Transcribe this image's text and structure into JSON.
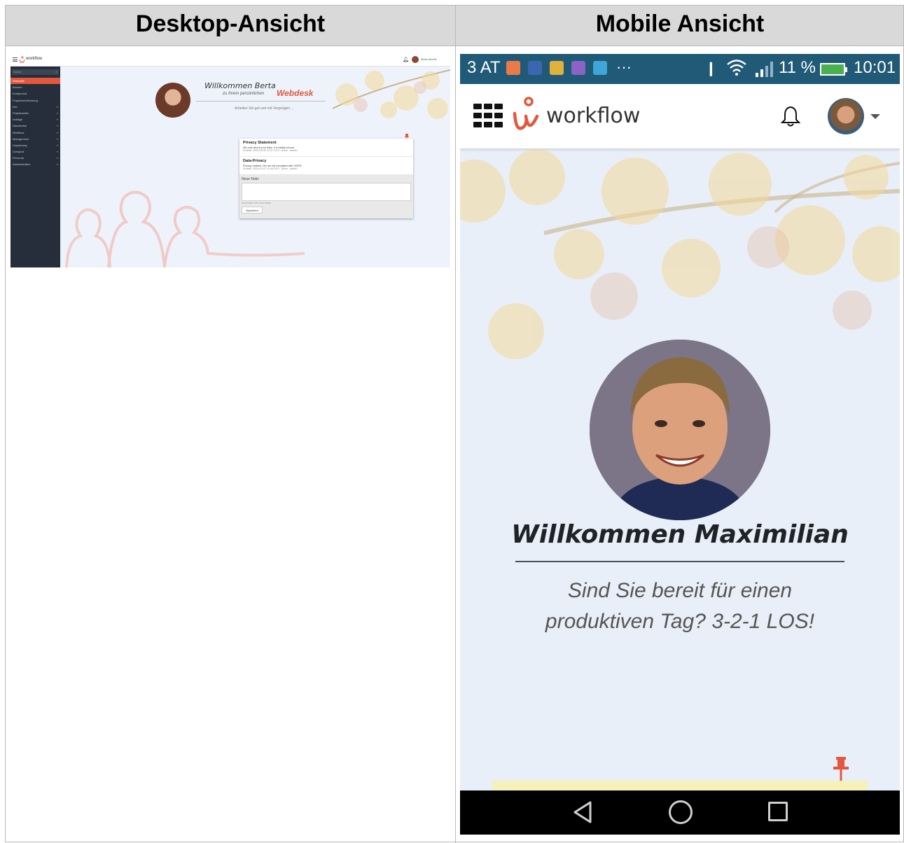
{
  "table": {
    "col_left_header": "Desktop-Ansicht",
    "col_right_header": "Mobile Ansicht"
  },
  "desktop": {
    "app_name": "workflow",
    "user_label": "Berta Abeziit",
    "search_placeholder": "Suche",
    "menu": [
      {
        "label": "Startseite",
        "active": true,
        "has_sub": false
      },
      {
        "label": "Buchen",
        "active": false,
        "has_sub": false
      },
      {
        "label": "Kontjournal",
        "active": false,
        "has_sub": false
      },
      {
        "label": "Projektzeit-Buchung",
        "active": false,
        "has_sub": false
      },
      {
        "label": "Info",
        "active": false,
        "has_sub": true
      },
      {
        "label": "Projektzeiten",
        "active": false,
        "has_sub": true
      },
      {
        "label": "Anträge",
        "active": false,
        "has_sub": true
      },
      {
        "label": "Dienstreise",
        "active": false,
        "has_sub": true
      },
      {
        "label": "Workflow",
        "active": false,
        "has_sub": true
      },
      {
        "label": "Management",
        "active": false,
        "has_sub": true
      },
      {
        "label": "Umplanung",
        "active": false,
        "has_sub": true
      },
      {
        "label": "Crewport",
        "active": false,
        "has_sub": true
      },
      {
        "label": "Personal",
        "active": false,
        "has_sub": true
      },
      {
        "label": "Administration",
        "active": false,
        "has_sub": true
      }
    ],
    "welcome": "Willkommen  Berta",
    "welcome_sub": "zu Ihrem persönlichen",
    "brand": "Webdesk",
    "tagline": "Arbeiten Sie gut und mit Vergnügen ...",
    "notes": [
      {
        "title": "Privacy Statement",
        "text": "We care about your data. It is totally secure.",
        "meta": "Erstellt:  2019-05-06 11:57:18.0 , Autor : admin"
      },
      {
        "title": "Data-Privacy",
        "text": "Privacy matters. We are full compliant with GDPR.",
        "meta": "Erstellt:  2019-03-07 11:45:38.0 , Autor : admin"
      }
    ],
    "new_note": {
      "title": "Neue Notiz",
      "placeholder": "Schreiben Sie eine Notiz",
      "save": "Speichern"
    }
  },
  "mobile": {
    "status": {
      "carrier": "3 AT",
      "more": "···",
      "battery_pct": "11 %",
      "time": "10:01"
    },
    "app_name": "workflow",
    "welcome": "Willkommen  Maximilian",
    "subtitle": "Sind Sie bereit für einen produktiven Tag? 3-2-1 LOS!"
  },
  "colors": {
    "accent": "#e4573d",
    "sidebar": "#252e3a",
    "status_bar": "#205a76"
  }
}
